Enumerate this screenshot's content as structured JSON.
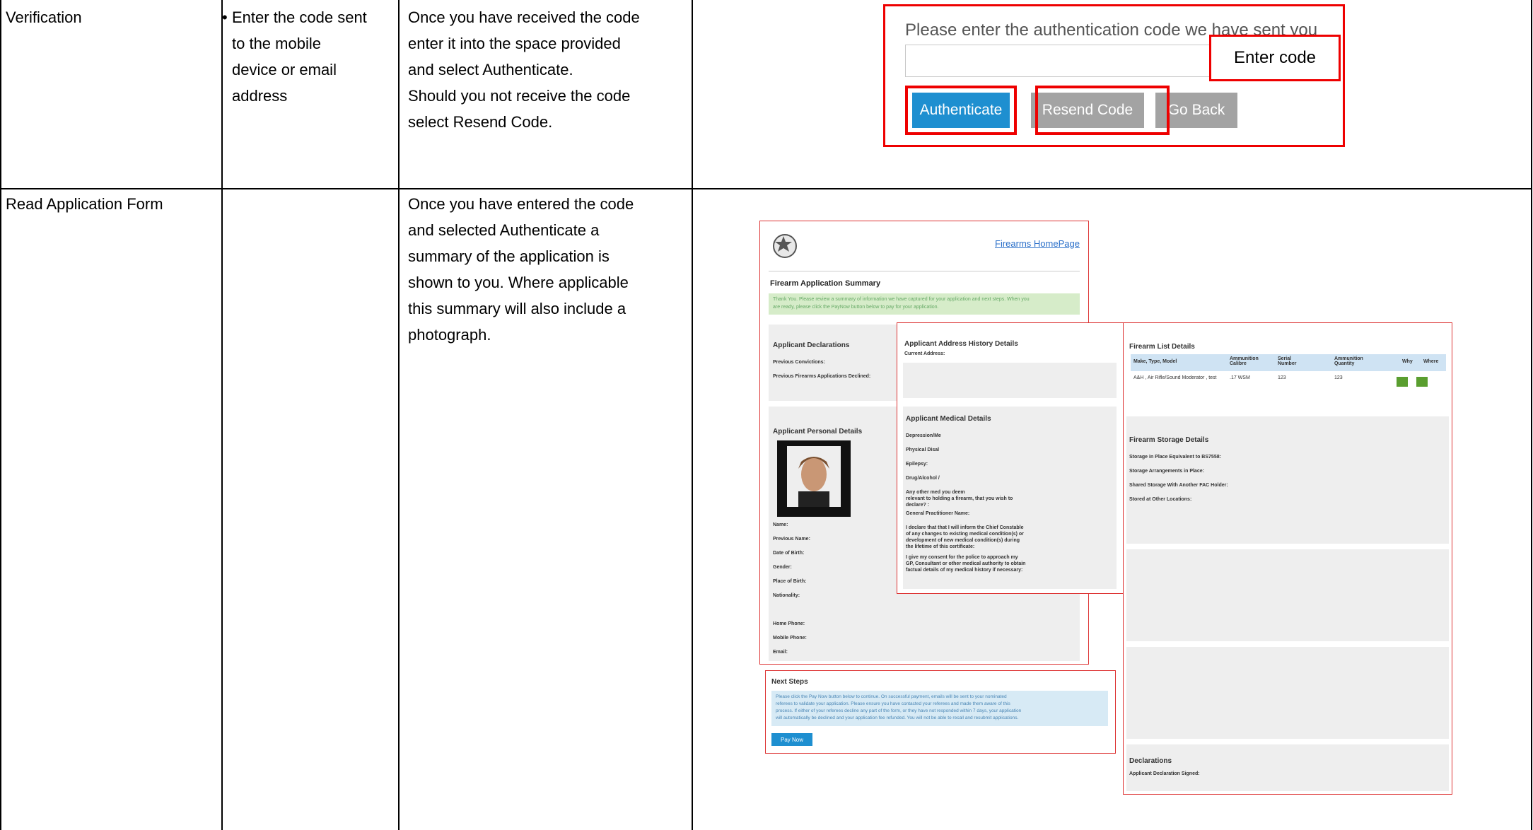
{
  "rows": [
    {
      "step": "Verification",
      "action": "Enter the code sent to the mobile device or email address",
      "action_lines": [
        "Enter the code sent",
        "to the mobile",
        "device or email",
        "address"
      ],
      "description_lines": [
        "Once you have received the code",
        "enter it into the space provided",
        "and select Authenticate.",
        "Should you not receive the code",
        "select Resend Code."
      ]
    },
    {
      "step": "Read Application Form",
      "action": "",
      "description_lines": [
        "Once you have entered the code",
        "and selected Authenticate a",
        "summary of the application is",
        "shown to you. Where applicable",
        "this summary will also include a",
        "photograph."
      ]
    }
  ],
  "auth_screen": {
    "prompt": "Please enter the authentication code we have sent you",
    "callout": "Enter code",
    "buttons": {
      "authenticate": "Authenticate",
      "resend": "Resend Code",
      "back": "Go Back"
    }
  },
  "summary_screen": {
    "homepage_link": "Firearms HomePage",
    "title": "Firearm Application Summary",
    "thanks_lines": [
      "Thank You. Please review a summary of information we have captured for your application and next steps. When you",
      "are ready, please click the PayNow button below to pay for your application."
    ],
    "declarations": {
      "title": "Applicant Declarations",
      "fields": [
        "Previous Convictions:",
        "Previous Firearms Applications Declined:"
      ]
    },
    "personal": {
      "title": "Applicant Personal Details",
      "fields": [
        "Name:",
        "Previous Name:",
        "Date of Birth:",
        "Gender:",
        "Place of Birth:",
        "Nationality:",
        "Home Phone:",
        "Mobile Phone:",
        "Email:"
      ]
    },
    "address": {
      "title": "Applicant Address History Details",
      "current": "Current Address:"
    },
    "medical": {
      "title": "Applicant Medical Details",
      "fields": [
        "Depression/Me",
        "Physical Disal",
        "Epilepsy:",
        "Drug/Alcohol /"
      ],
      "other_lines": [
        "Any other med                          you deem",
        "relevant to holding a firearm, that you wish to",
        "declare? :"
      ],
      "gp": "General Practitioner Name:",
      "declare_lines": [
        "I declare that that I will inform the Chief Constable",
        "of any changes to existing medical condition(s) or",
        "development of new medical condition(s) during",
        "the lifetime of this certificate:"
      ],
      "consent_lines": [
        "I give my consent for the police to approach my",
        "GP, Consultant or other medical authority to obtain",
        "factual details of my medical history if necessary:"
      ]
    },
    "firearm_list": {
      "title": "Firearm List Details",
      "headers": [
        "Make, Type, Model",
        "Ammunition Calibre",
        "Serial Number",
        "Ammunition Quantity",
        "Why",
        "Where"
      ],
      "row": [
        "A&H , Air Rifle/Sound Moderator , test",
        ".17 WSM",
        "123",
        "123"
      ]
    },
    "storage": {
      "title": "Firearm Storage Details",
      "fields": [
        "Storage in Place Equivalent to BS7558:",
        "Storage Arrangements in Place:",
        "Shared Storage With Another FAC Holder:",
        "Stored at Other Locations:"
      ]
    },
    "final_declarations": {
      "title": "Declarations",
      "field": "Applicant Declaration Signed:"
    },
    "next_steps": {
      "title": "Next Steps",
      "lines": [
        "Please click the Pay Now button below to continue. On successful payment, emails will be sent to your nominated",
        "referees to validate your application. Please ensure you have contacted your referees and made them aware of this",
        "process. If either of your referees decline any part of the form, or they have not responded within 7 days, your application",
        "will automatically be declined and your application fee refunded. You will not be able to recall and resubmit applications."
      ],
      "pay_button": "Pay Now"
    },
    "icons": [
      "police-badge-icon",
      "passport-photo-icon",
      "info-icon"
    ]
  }
}
